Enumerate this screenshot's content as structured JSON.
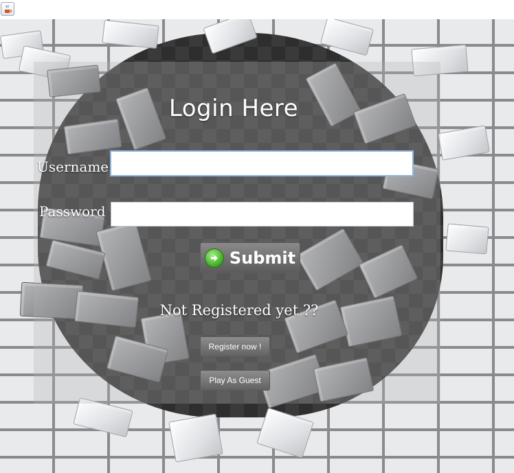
{
  "window": {
    "icon": "java-coffee-cup-icon"
  },
  "login": {
    "title": "Login Here",
    "username_label": "Username",
    "username_value": "",
    "password_label": "Password",
    "password_value": "",
    "submit_label": "Submit",
    "submit_icon": "green-arrow-icon"
  },
  "register": {
    "prompt": "Not Registered yet ??",
    "register_label": "Register now !",
    "guest_label": "Play As Guest"
  },
  "colors": {
    "panel_text": "#ffffff",
    "button_gray": "#6e6e6e",
    "go_green": "#3aa81f"
  }
}
